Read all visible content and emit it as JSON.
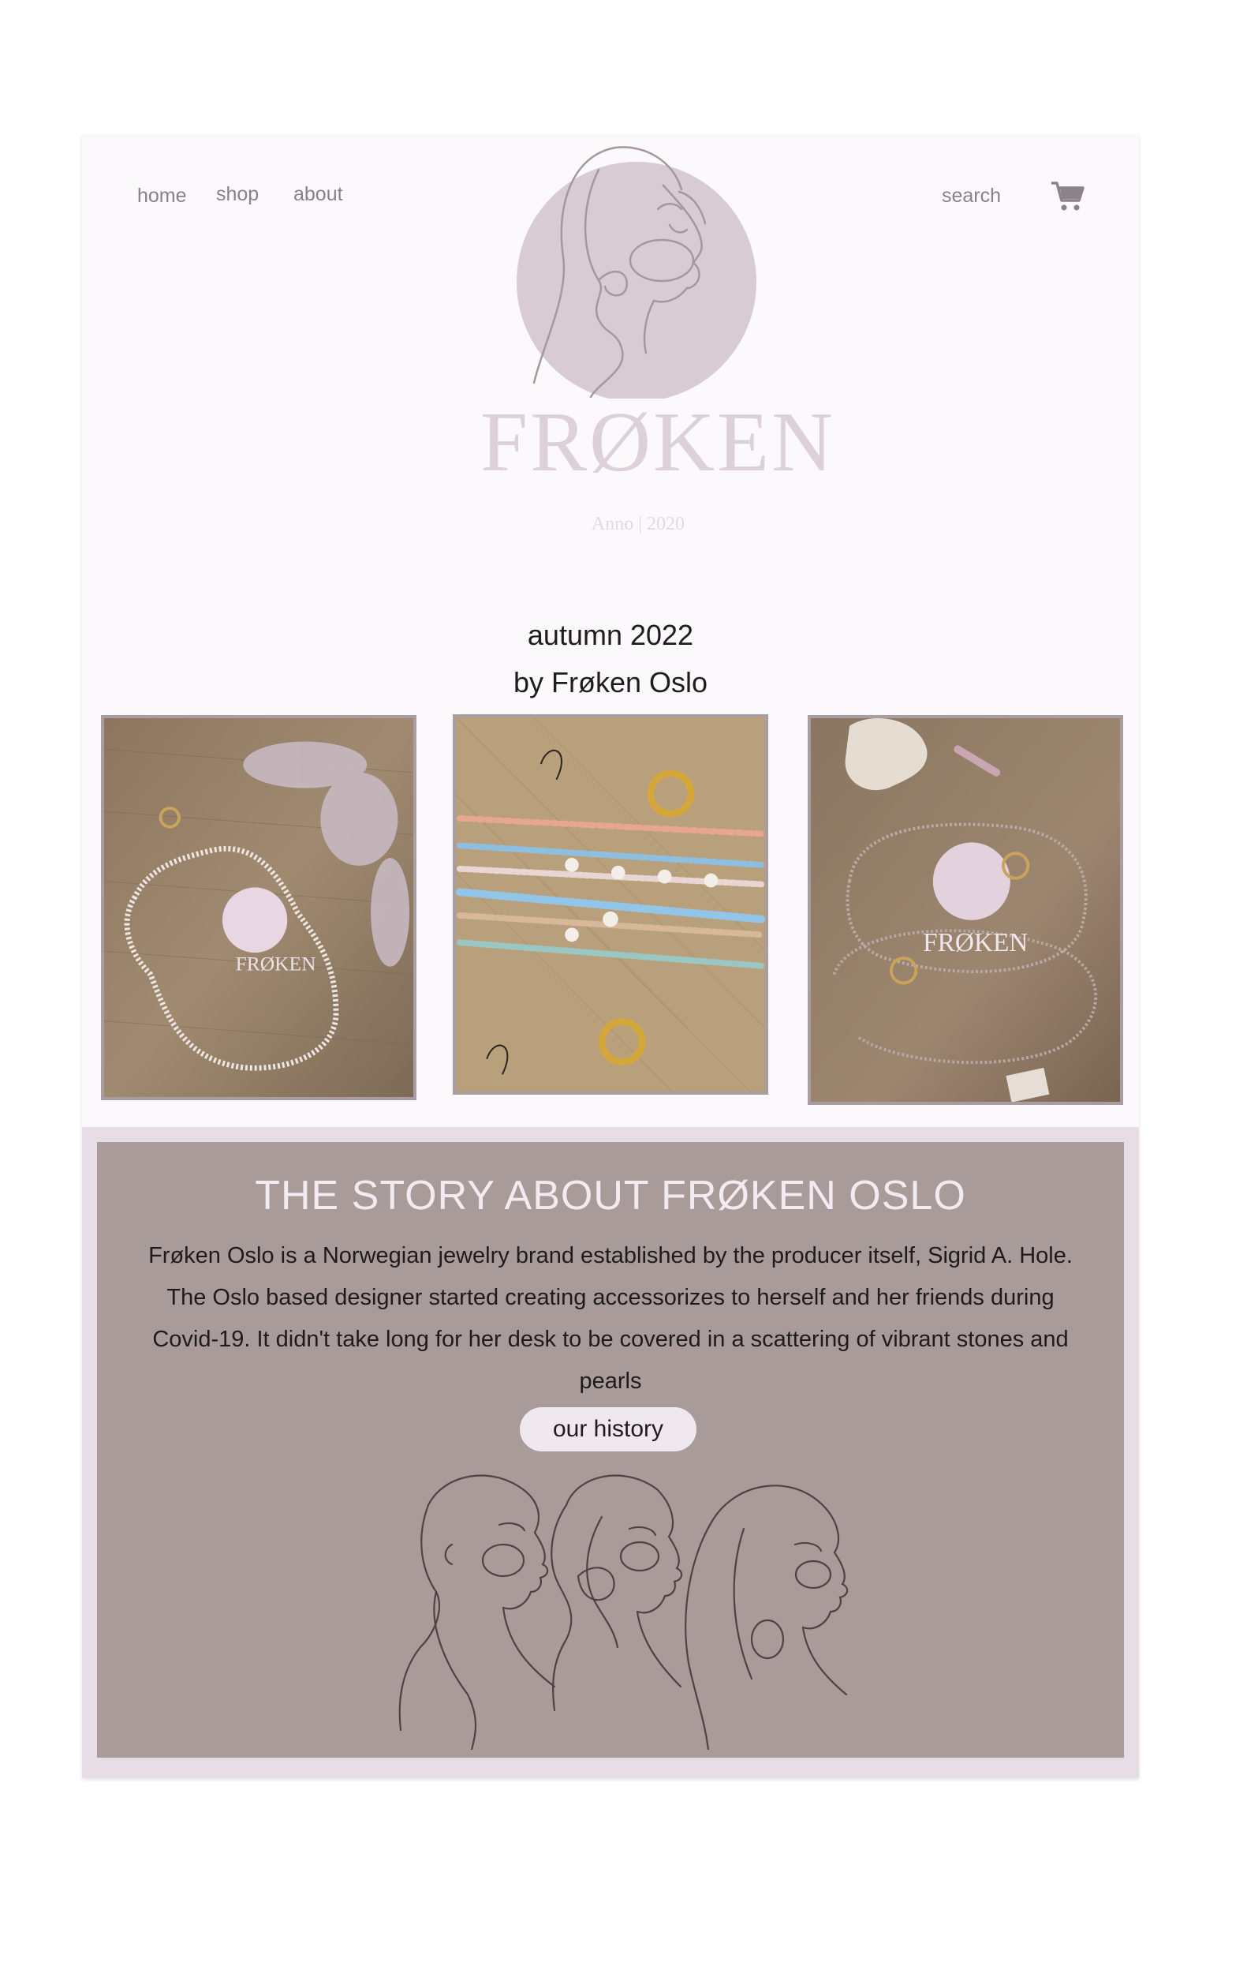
{
  "nav": {
    "home_label": "home",
    "shop_label": "shop",
    "about_label": "about",
    "search_label": "search",
    "cart_icon": "shopping-cart-icon"
  },
  "logo": {
    "name": "FRØKEN",
    "year": "Anno | 2020"
  },
  "collection": {
    "title_line1": "autumn 2022",
    "title_line2": "by Frøken Oslo"
  },
  "story": {
    "title": "THE STORY ABOUT FRØKEN OSLO",
    "body": "Frøken Oslo is a Norwegian jewelry brand established by the producer itself, Sigrid A. Hole. The Oslo based designer started creating accessorizes to herself and her friends during Covid-19. It didn't take long for her desk to be covered in a scattering of vibrant stones and pearls",
    "button_label": "our history"
  },
  "colors": {
    "page_bg": "#fcf9fc",
    "logo_circle": "#d8cbd4",
    "story_bg": "#aa9b9b",
    "story_border": "#e7dde7",
    "button_bg": "#f0e8ef"
  }
}
